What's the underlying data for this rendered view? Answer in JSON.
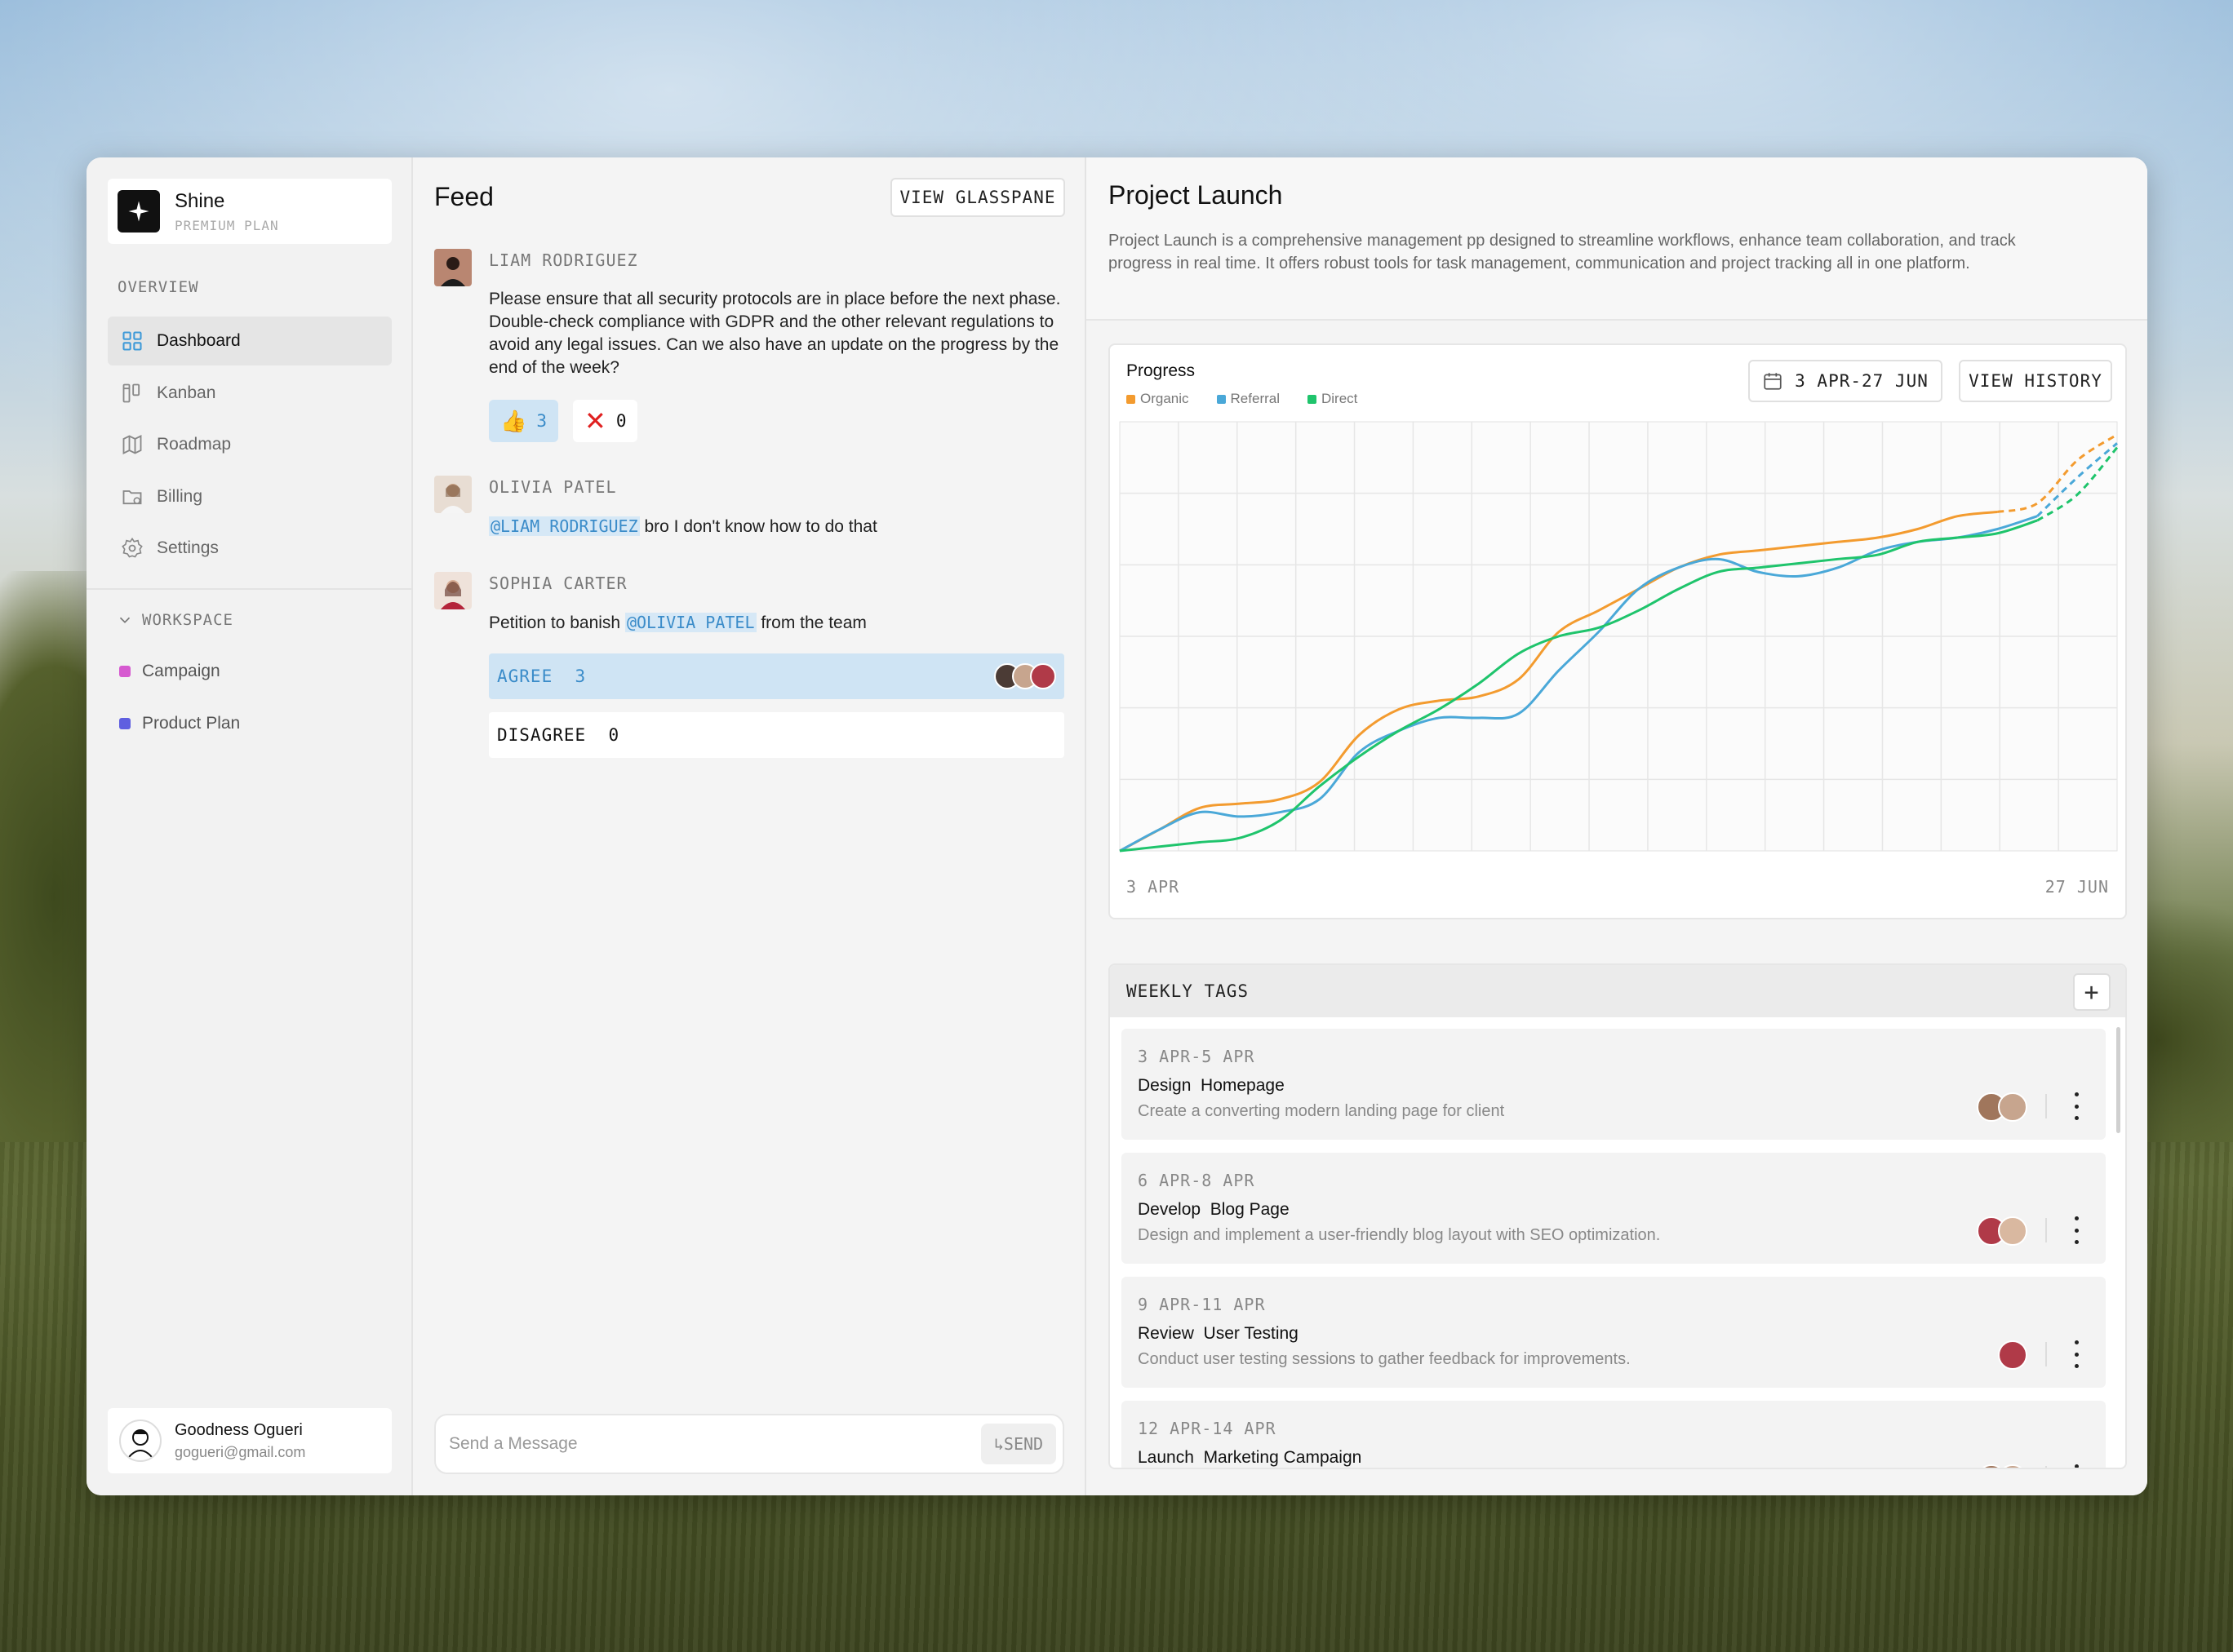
{
  "brand": {
    "name": "Shine",
    "plan": "PREMIUM PLAN"
  },
  "sidebar": {
    "overview_label": "OVERVIEW",
    "items": [
      {
        "label": "Dashboard",
        "icon": "grid-icon",
        "active": true
      },
      {
        "label": "Kanban",
        "icon": "kanban-icon"
      },
      {
        "label": "Roadmap",
        "icon": "map-icon"
      },
      {
        "label": "Billing",
        "icon": "folder-dollar-icon"
      },
      {
        "label": "Settings",
        "icon": "gear-icon"
      }
    ],
    "workspace_label": "WORKSPACE",
    "workspace_items": [
      {
        "label": "Campaign",
        "color": "#d65ad0"
      },
      {
        "label": "Product Plan",
        "color": "#5f5fe0"
      }
    ],
    "user": {
      "name": "Goodness Ogueri",
      "email": "gogueri@gmail.com"
    }
  },
  "feed": {
    "title": "Feed",
    "view_button": "VIEW GLASSPANE",
    "posts": [
      {
        "author": "LIAM RODRIGUEZ",
        "text": "Please ensure that all security protocols are in place before the next phase. Double-check compliance with GDPR and the other relevant regulations to avoid any legal issues. Can we also have an update on the progress by the end of the week?",
        "reactions": [
          {
            "icon": "thumbs-up-icon",
            "count": "3"
          },
          {
            "icon": "cross-icon",
            "count": "0"
          }
        ]
      },
      {
        "author": "OLIVIA PATEL",
        "mention": "@LIAM RODRIGUEZ",
        "text": " bro I don't know how to do that"
      },
      {
        "author": "SOPHIA CARTER",
        "text_before": "Petition to banish ",
        "mention": "@OLIVIA PATEL",
        "text_after": " from the team",
        "poll": [
          {
            "label": "AGREE",
            "count": "3"
          },
          {
            "label": "DISAGREE",
            "count": "0"
          }
        ]
      }
    ],
    "input_placeholder": "Send a Message",
    "send_label": "↳SEND"
  },
  "project": {
    "title": "Project Launch",
    "description": "Project Launch is a comprehensive management pp designed to streamline workflows, enhance team collaboration, and track progress in real time. It offers robust tools for task management, communication and project tracking all in one platform.",
    "date_range": "3 APR-27 JUN",
    "history_button": "VIEW HISTORY"
  },
  "chart_data": {
    "type": "line",
    "title": "Progress",
    "x_start_label": "3 APR",
    "x_end_label": "27 JUN",
    "grid": true,
    "ylim": [
      0,
      100
    ],
    "x": [
      0,
      4,
      8,
      12,
      16,
      20,
      24,
      28,
      32,
      36,
      40,
      44,
      48,
      52,
      56,
      60,
      64,
      68,
      72,
      76,
      80,
      84,
      88,
      92,
      96,
      100
    ],
    "series": [
      {
        "name": "Organic",
        "color": "#f39b2f",
        "values": [
          0,
          5,
          10,
          11,
          12,
          16,
          27,
          33,
          35,
          36,
          40,
          51,
          56,
          61,
          66,
          69,
          70,
          71,
          72,
          73,
          75,
          78,
          79,
          81,
          91,
          97
        ],
        "projected_from": 88
      },
      {
        "name": "Referral",
        "color": "#4aa8d8",
        "values": [
          0,
          5,
          9,
          8,
          9,
          12,
          23,
          28,
          31,
          31,
          32,
          42,
          51,
          61,
          66,
          68,
          65,
          64,
          66,
          70,
          72,
          73,
          75,
          78,
          87,
          95
        ],
        "projected_from": 92
      },
      {
        "name": "Direct",
        "color": "#1fc46c",
        "values": [
          0,
          1,
          2,
          3,
          7,
          15,
          22,
          28,
          33,
          39,
          46,
          50,
          52,
          56,
          61,
          65,
          66,
          67,
          68,
          69,
          72,
          73,
          74,
          77,
          83,
          94
        ],
        "projected_from": 92
      }
    ]
  },
  "weekly_tags": {
    "title": "WEEKLY TAGS",
    "items": [
      {
        "date": "3 APR-5 APR",
        "title": "Design  Homepage",
        "desc": "Create a converting modern landing page for client",
        "avatars": [
          "#a0765c",
          "#c7a58e"
        ]
      },
      {
        "date": "6 APR-8 APR",
        "title": "Develop  Blog Page",
        "desc": "Design and implement a user-friendly blog layout with SEO optimization.",
        "avatars": [
          "#b03a48",
          "#d9b8a0"
        ]
      },
      {
        "date": "9 APR-11 APR",
        "title": "Review  User Testing",
        "desc": "Conduct user testing sessions to gather feedback for improvements.",
        "avatars": [
          "#b03a48"
        ]
      },
      {
        "date": "12 APR-14 APR",
        "title": "Launch  Marketing Campaign",
        "desc": "",
        "avatars": [
          "#a0765c",
          "#c7a58e"
        ]
      }
    ]
  }
}
